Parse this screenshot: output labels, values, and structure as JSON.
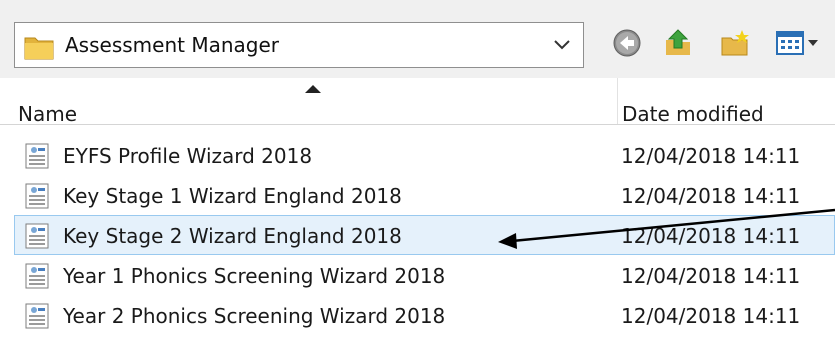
{
  "location": {
    "value": "Assessment Manager",
    "icon": "folder-icon"
  },
  "toolbar": {
    "buttons": [
      {
        "name": "back-icon"
      },
      {
        "name": "up-folder-icon"
      },
      {
        "name": "new-folder-icon"
      },
      {
        "name": "view-menu-icon"
      }
    ]
  },
  "columns": {
    "name": "Name",
    "date": "Date modified",
    "sort": "ascending"
  },
  "files": [
    {
      "name": "EYFS Profile Wizard 2018",
      "date": "12/04/2018 14:11",
      "selected": false
    },
    {
      "name": "Key Stage 1 Wizard England 2018",
      "date": "12/04/2018 14:11",
      "selected": false
    },
    {
      "name": "Key Stage 2 Wizard England 2018",
      "date": "12/04/2018 14:11",
      "selected": true
    },
    {
      "name": "Year 1 Phonics Screening Wizard 2018",
      "date": "12/04/2018 14:11",
      "selected": false
    },
    {
      "name": "Year 2 Phonics Screening Wizard 2018",
      "date": "12/04/2018 14:11",
      "selected": false
    }
  ],
  "colors": {
    "selection_bg": "#e5f1fb",
    "selection_border": "#99c9ef",
    "annotation_arrow": "#000000"
  }
}
